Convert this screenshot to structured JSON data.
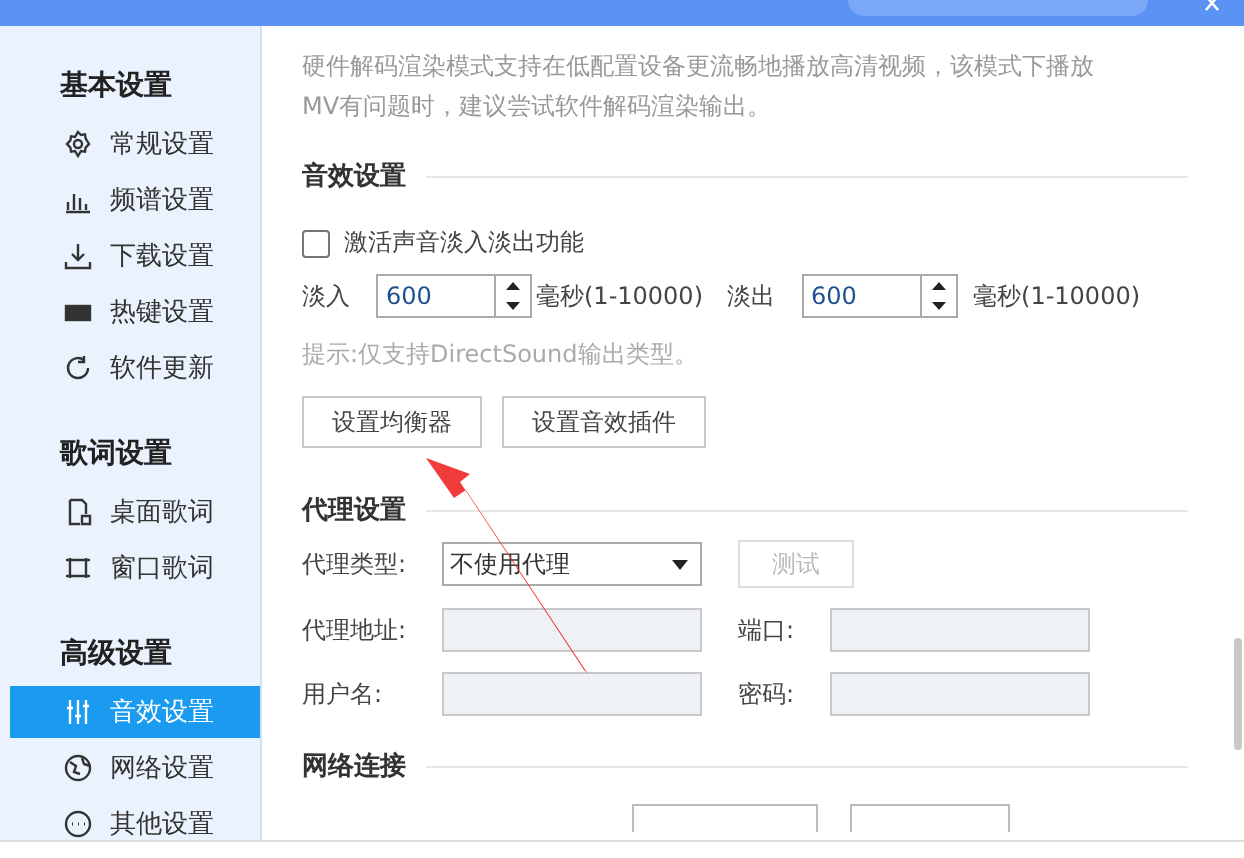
{
  "sidebar": {
    "groups": [
      {
        "title": "基本设置",
        "items": [
          {
            "label": "常规设置",
            "selected": false
          },
          {
            "label": "频谱设置",
            "selected": false
          },
          {
            "label": "下载设置",
            "selected": false
          },
          {
            "label": "热键设置",
            "selected": false
          },
          {
            "label": "软件更新",
            "selected": false
          }
        ]
      },
      {
        "title": "歌词设置",
        "items": [
          {
            "label": "桌面歌词",
            "selected": false
          },
          {
            "label": "窗口歌词",
            "selected": false
          }
        ]
      },
      {
        "title": "高级设置",
        "items": [
          {
            "label": "音效设置",
            "selected": true
          },
          {
            "label": "网络设置",
            "selected": false
          },
          {
            "label": "其他设置",
            "selected": false
          }
        ]
      }
    ]
  },
  "content": {
    "notice": "硬件解码渲染模式支持在低配置设备更流畅地播放高清视频，该模式下播放MV有问题时，建议尝试软件解码渲染输出。",
    "audio": {
      "title": "音效设置",
      "fade_checkbox": {
        "label": "激活声音淡入淡出功能",
        "checked": false
      },
      "fades": [
        {
          "label": "淡入",
          "value": "600",
          "unit": "毫秒(1-10000)"
        },
        {
          "label": "淡出",
          "value": "600",
          "unit": "毫秒(1-10000)"
        }
      ],
      "hint": "提示:仅支持DirectSound输出类型。",
      "buttons": [
        "设置均衡器",
        "设置音效插件"
      ]
    },
    "proxy": {
      "title": "代理设置",
      "type": {
        "label": "代理类型:",
        "value": "不使用代理"
      },
      "test_button": {
        "label": "测试",
        "disabled": true
      },
      "fields": [
        {
          "label": "代理地址:",
          "disabled": true
        },
        {
          "label": "端口:",
          "disabled": true
        },
        {
          "label": "用户名:",
          "disabled": true
        },
        {
          "label": "密码:",
          "disabled": true
        }
      ]
    },
    "network": {
      "title": "网络连接"
    }
  }
}
